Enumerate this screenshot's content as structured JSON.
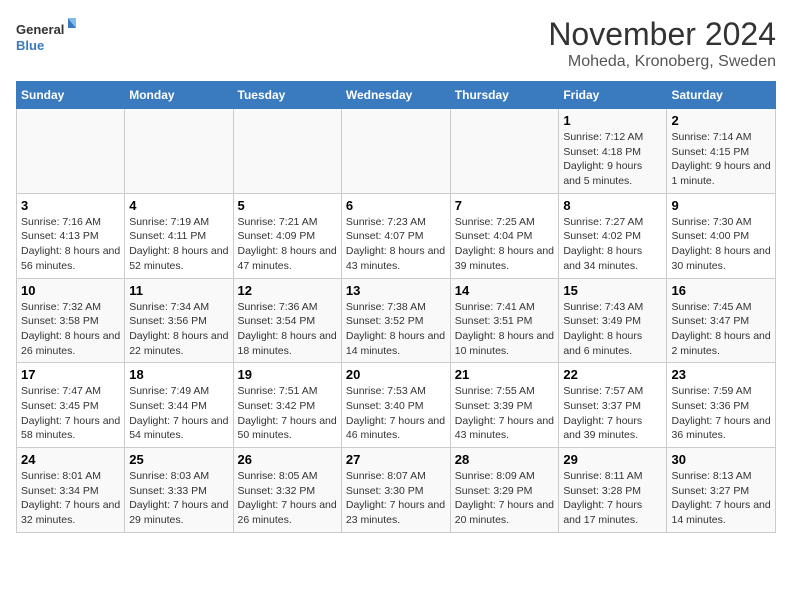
{
  "header": {
    "logo_line1": "General",
    "logo_line2": "Blue",
    "month_title": "November 2024",
    "subtitle": "Moheda, Kronoberg, Sweden"
  },
  "weekdays": [
    "Sunday",
    "Monday",
    "Tuesday",
    "Wednesday",
    "Thursday",
    "Friday",
    "Saturday"
  ],
  "weeks": [
    [
      {
        "day": "",
        "sunrise": "",
        "sunset": "",
        "daylight": ""
      },
      {
        "day": "",
        "sunrise": "",
        "sunset": "",
        "daylight": ""
      },
      {
        "day": "",
        "sunrise": "",
        "sunset": "",
        "daylight": ""
      },
      {
        "day": "",
        "sunrise": "",
        "sunset": "",
        "daylight": ""
      },
      {
        "day": "",
        "sunrise": "",
        "sunset": "",
        "daylight": ""
      },
      {
        "day": "1",
        "sunrise": "Sunrise: 7:12 AM",
        "sunset": "Sunset: 4:18 PM",
        "daylight": "Daylight: 9 hours and 5 minutes."
      },
      {
        "day": "2",
        "sunrise": "Sunrise: 7:14 AM",
        "sunset": "Sunset: 4:15 PM",
        "daylight": "Daylight: 9 hours and 1 minute."
      }
    ],
    [
      {
        "day": "3",
        "sunrise": "Sunrise: 7:16 AM",
        "sunset": "Sunset: 4:13 PM",
        "daylight": "Daylight: 8 hours and 56 minutes."
      },
      {
        "day": "4",
        "sunrise": "Sunrise: 7:19 AM",
        "sunset": "Sunset: 4:11 PM",
        "daylight": "Daylight: 8 hours and 52 minutes."
      },
      {
        "day": "5",
        "sunrise": "Sunrise: 7:21 AM",
        "sunset": "Sunset: 4:09 PM",
        "daylight": "Daylight: 8 hours and 47 minutes."
      },
      {
        "day": "6",
        "sunrise": "Sunrise: 7:23 AM",
        "sunset": "Sunset: 4:07 PM",
        "daylight": "Daylight: 8 hours and 43 minutes."
      },
      {
        "day": "7",
        "sunrise": "Sunrise: 7:25 AM",
        "sunset": "Sunset: 4:04 PM",
        "daylight": "Daylight: 8 hours and 39 minutes."
      },
      {
        "day": "8",
        "sunrise": "Sunrise: 7:27 AM",
        "sunset": "Sunset: 4:02 PM",
        "daylight": "Daylight: 8 hours and 34 minutes."
      },
      {
        "day": "9",
        "sunrise": "Sunrise: 7:30 AM",
        "sunset": "Sunset: 4:00 PM",
        "daylight": "Daylight: 8 hours and 30 minutes."
      }
    ],
    [
      {
        "day": "10",
        "sunrise": "Sunrise: 7:32 AM",
        "sunset": "Sunset: 3:58 PM",
        "daylight": "Daylight: 8 hours and 26 minutes."
      },
      {
        "day": "11",
        "sunrise": "Sunrise: 7:34 AM",
        "sunset": "Sunset: 3:56 PM",
        "daylight": "Daylight: 8 hours and 22 minutes."
      },
      {
        "day": "12",
        "sunrise": "Sunrise: 7:36 AM",
        "sunset": "Sunset: 3:54 PM",
        "daylight": "Daylight: 8 hours and 18 minutes."
      },
      {
        "day": "13",
        "sunrise": "Sunrise: 7:38 AM",
        "sunset": "Sunset: 3:52 PM",
        "daylight": "Daylight: 8 hours and 14 minutes."
      },
      {
        "day": "14",
        "sunrise": "Sunrise: 7:41 AM",
        "sunset": "Sunset: 3:51 PM",
        "daylight": "Daylight: 8 hours and 10 minutes."
      },
      {
        "day": "15",
        "sunrise": "Sunrise: 7:43 AM",
        "sunset": "Sunset: 3:49 PM",
        "daylight": "Daylight: 8 hours and 6 minutes."
      },
      {
        "day": "16",
        "sunrise": "Sunrise: 7:45 AM",
        "sunset": "Sunset: 3:47 PM",
        "daylight": "Daylight: 8 hours and 2 minutes."
      }
    ],
    [
      {
        "day": "17",
        "sunrise": "Sunrise: 7:47 AM",
        "sunset": "Sunset: 3:45 PM",
        "daylight": "Daylight: 7 hours and 58 minutes."
      },
      {
        "day": "18",
        "sunrise": "Sunrise: 7:49 AM",
        "sunset": "Sunset: 3:44 PM",
        "daylight": "Daylight: 7 hours and 54 minutes."
      },
      {
        "day": "19",
        "sunrise": "Sunrise: 7:51 AM",
        "sunset": "Sunset: 3:42 PM",
        "daylight": "Daylight: 7 hours and 50 minutes."
      },
      {
        "day": "20",
        "sunrise": "Sunrise: 7:53 AM",
        "sunset": "Sunset: 3:40 PM",
        "daylight": "Daylight: 7 hours and 46 minutes."
      },
      {
        "day": "21",
        "sunrise": "Sunrise: 7:55 AM",
        "sunset": "Sunset: 3:39 PM",
        "daylight": "Daylight: 7 hours and 43 minutes."
      },
      {
        "day": "22",
        "sunrise": "Sunrise: 7:57 AM",
        "sunset": "Sunset: 3:37 PM",
        "daylight": "Daylight: 7 hours and 39 minutes."
      },
      {
        "day": "23",
        "sunrise": "Sunrise: 7:59 AM",
        "sunset": "Sunset: 3:36 PM",
        "daylight": "Daylight: 7 hours and 36 minutes."
      }
    ],
    [
      {
        "day": "24",
        "sunrise": "Sunrise: 8:01 AM",
        "sunset": "Sunset: 3:34 PM",
        "daylight": "Daylight: 7 hours and 32 minutes."
      },
      {
        "day": "25",
        "sunrise": "Sunrise: 8:03 AM",
        "sunset": "Sunset: 3:33 PM",
        "daylight": "Daylight: 7 hours and 29 minutes."
      },
      {
        "day": "26",
        "sunrise": "Sunrise: 8:05 AM",
        "sunset": "Sunset: 3:32 PM",
        "daylight": "Daylight: 7 hours and 26 minutes."
      },
      {
        "day": "27",
        "sunrise": "Sunrise: 8:07 AM",
        "sunset": "Sunset: 3:30 PM",
        "daylight": "Daylight: 7 hours and 23 minutes."
      },
      {
        "day": "28",
        "sunrise": "Sunrise: 8:09 AM",
        "sunset": "Sunset: 3:29 PM",
        "daylight": "Daylight: 7 hours and 20 minutes."
      },
      {
        "day": "29",
        "sunrise": "Sunrise: 8:11 AM",
        "sunset": "Sunset: 3:28 PM",
        "daylight": "Daylight: 7 hours and 17 minutes."
      },
      {
        "day": "30",
        "sunrise": "Sunrise: 8:13 AM",
        "sunset": "Sunset: 3:27 PM",
        "daylight": "Daylight: 7 hours and 14 minutes."
      }
    ]
  ]
}
